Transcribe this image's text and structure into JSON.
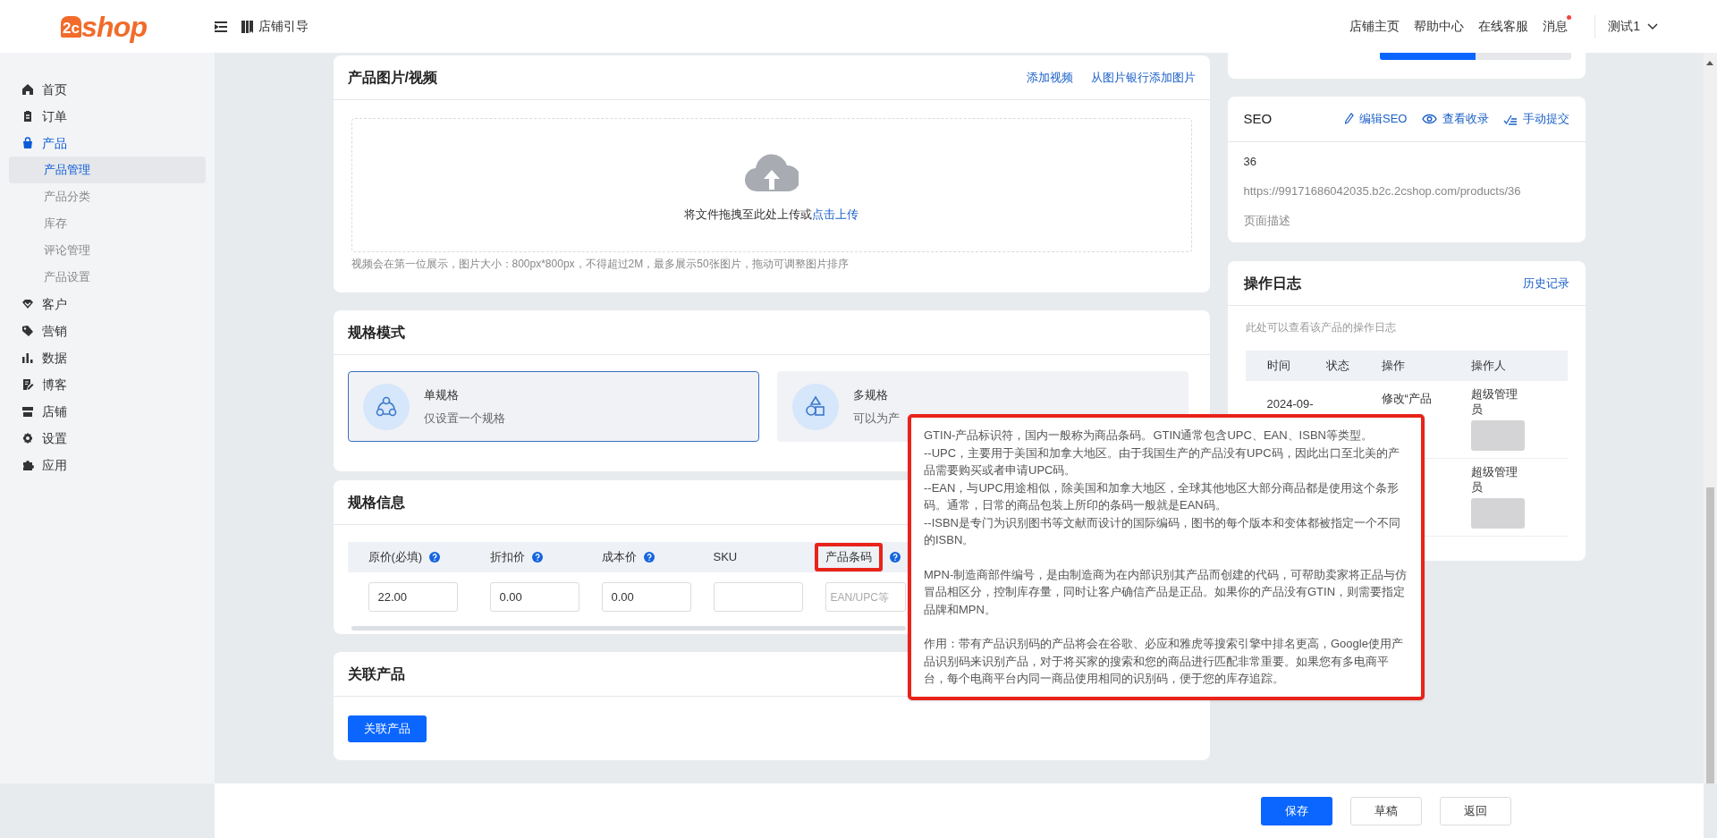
{
  "header": {
    "logo": {
      "mark": "2c",
      "text": "shop"
    },
    "guide": "店铺引导",
    "links": [
      {
        "label": "店铺主页",
        "notification": false
      },
      {
        "label": "帮助中心",
        "notification": false
      },
      {
        "label": "在线客服",
        "notification": false
      },
      {
        "label": "消息",
        "notification": true
      }
    ],
    "user": "测试1"
  },
  "sidebar": {
    "items": [
      {
        "label": "首页",
        "selected": false
      },
      {
        "label": "订单",
        "selected": false
      },
      {
        "label": "产品",
        "selected": true,
        "expanded": true,
        "children": [
          {
            "label": "产品管理",
            "selected": true
          },
          {
            "label": "产品分类",
            "selected": false
          },
          {
            "label": "库存",
            "selected": false
          },
          {
            "label": "评论管理",
            "selected": false
          },
          {
            "label": "产品设置",
            "selected": false
          }
        ]
      },
      {
        "label": "客户",
        "selected": false
      },
      {
        "label": "营销",
        "selected": false
      },
      {
        "label": "数据",
        "selected": false
      },
      {
        "label": "博客",
        "selected": false
      },
      {
        "label": "店铺",
        "selected": false
      },
      {
        "label": "设置",
        "selected": false
      },
      {
        "label": "应用",
        "selected": false
      }
    ]
  },
  "media_card": {
    "title": "产品图片/视频",
    "actions": [
      "添加视频",
      "从图片银行添加图片"
    ],
    "dropzone": {
      "text": "将文件拖拽至此处上传或",
      "link": "点击上传"
    },
    "hint": "视频会在第一位展示，图片大小：800px*800px，不得超过2M，最多展示50张图片，拖动可调整图片排序"
  },
  "spec_mode": {
    "title": "规格模式",
    "options": [
      {
        "title": "单规格",
        "description": "仅设置一个规格",
        "selected": true
      },
      {
        "title": "多规格",
        "description": "可以为产",
        "selected": false
      }
    ]
  },
  "spec_info": {
    "title": "规格信息",
    "columns": [
      {
        "label": "原价(必填)",
        "help": true,
        "value": "22.00"
      },
      {
        "label": "折扣价",
        "help": true,
        "value": "0.00"
      },
      {
        "label": "成本价",
        "help": true,
        "value": "0.00"
      },
      {
        "label": "SKU"
      },
      {
        "label": "产品条码",
        "help": true,
        "highlighted": true,
        "placeholder": "EAN/UPC等"
      }
    ]
  },
  "related": {
    "title": "关联产品",
    "button": "关联产品"
  },
  "top_right_card": {
    "progress": {
      "level": 0.5
    }
  },
  "seo": {
    "title": "SEO",
    "actions": [
      "编辑SEO",
      "查看收录",
      "手动提交"
    ],
    "handle": "36",
    "url": "https://99171686042035.b2c.2cshop.com/products/36",
    "description": "页面描述"
  },
  "log": {
    "title": "操作日志",
    "link": "历史记录",
    "description": "此处可以查看该产品的操作日志",
    "columns": [
      "时间",
      "状态",
      "操作",
      "操作人"
    ],
    "rows": [
      {
        "time": "2024-09-",
        "action": "修改“产品",
        "operator": "超级管理员"
      },
      {
        "operator": "超级管理员"
      }
    ]
  },
  "tooltip": {
    "paragraphs": [
      [
        "GTIN-产品标识符，国内一般称为商品条码。GTIN通常包含UPC、EAN、ISBN等类型。",
        "--UPC，主要用于美国和加拿大地区。由于我国生产的产品没有UPC码，因此出口至北美的产品需要购买或者申请UPC码。",
        "--EAN，与UPC用途相似，除美国和加拿大地区，全球其他地区大部分商品都是使用这个条形码。通常，日常的商品包装上所印的条码一般就是EAN码。",
        "--ISBN是专门为识别图书等文献而设计的国际编码，图书的每个版本和变体都被指定一个不同的ISBN。"
      ],
      [
        "MPN-制造商部件编号，是由制造商为在内部识别其产品而创建的代码，可帮助卖家将正品与仿冒品相区分，控制库存量，同时让客户确信产品是正品。如果你的产品没有GTIN，则需要指定品牌和MPN。"
      ],
      [
        "作用：带有产品识别码的产品将会在谷歌、必应和雅虎等搜索引擎中排名更高，Google使用产品识别码来识别产品，对于将买家的搜索和您的商品进行匹配非常重要。如果您有多电商平台，每个电商平台内同一商品使用相同的识别码，便于您的库存追踪。"
      ]
    ]
  },
  "footer": {
    "buttons": [
      {
        "label": "保存",
        "primary": true
      },
      {
        "label": "草稿",
        "primary": false
      },
      {
        "label": "返回",
        "primary": false
      }
    ]
  }
}
